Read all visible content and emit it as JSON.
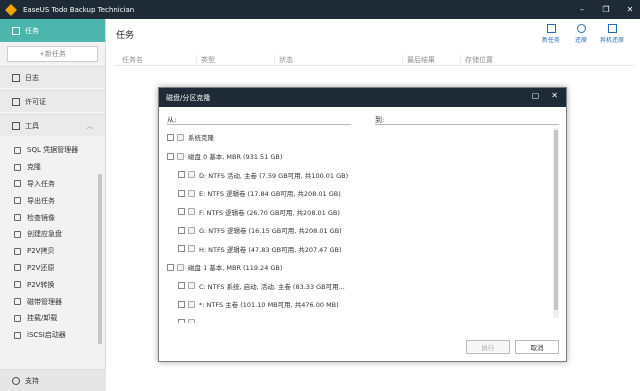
{
  "app": {
    "title": "EaseUS Todo Backup Technician"
  },
  "sidebar": {
    "task_label": "任务",
    "new_task_label": "+新任务",
    "log_label": "日志",
    "license_label": "许可证",
    "tools_label": "工具",
    "tools": [
      "SQL 凭据管理器",
      "克隆",
      "导入任务",
      "导出任务",
      "检查镜像",
      "创建应急盘",
      "P2V拷贝",
      "P2V还原",
      "P2V转换",
      "磁带管理器",
      "挂载/卸载",
      "iSCSI启动器"
    ],
    "support_label": "支持"
  },
  "main": {
    "title": "任务",
    "toolbar": {
      "new_task": "新任务",
      "restore": "还原",
      "heterogeneous_restore": "异机还原"
    },
    "columns": [
      "任务名",
      "类型",
      "状态",
      "最后结果",
      "存储位置"
    ]
  },
  "dialog": {
    "title": "磁盘/分区克隆",
    "from_label": "从:",
    "to_label": "到:",
    "tree": [
      {
        "level": 0,
        "label": "系统克隆"
      },
      {
        "level": 0,
        "label": "磁盘 0 基本, MBR (931.51 GB)"
      },
      {
        "level": 1,
        "label": "D: NTFS 活动, 主卷 (7.59 GB可用, 共100.01 GB)"
      },
      {
        "level": 1,
        "label": "E: NTFS 逻辑卷 (17.84 GB可用, 共208.01 GB)"
      },
      {
        "level": 1,
        "label": "F: NTFS 逻辑卷 (26.70 GB可用, 共208.01 GB)"
      },
      {
        "level": 1,
        "label": "G: NTFS 逻辑卷 (16.15 GB可用, 共208.01 GB)"
      },
      {
        "level": 1,
        "label": "H: NTFS 逻辑卷 (47.83 GB可用, 共207.47 GB)"
      },
      {
        "level": 0,
        "label": "磁盘 1 基本, MBR (119.24 GB)"
      },
      {
        "level": 1,
        "label": "C: NTFS 系统, 启动, 活动, 主卷 (83.33 GB可用..."
      },
      {
        "level": 1,
        "label": "*: NTFS 主卷 (101.10 MB可用, 共476.00 MB)"
      }
    ],
    "execute_label": "执行",
    "cancel_label": "取消"
  }
}
